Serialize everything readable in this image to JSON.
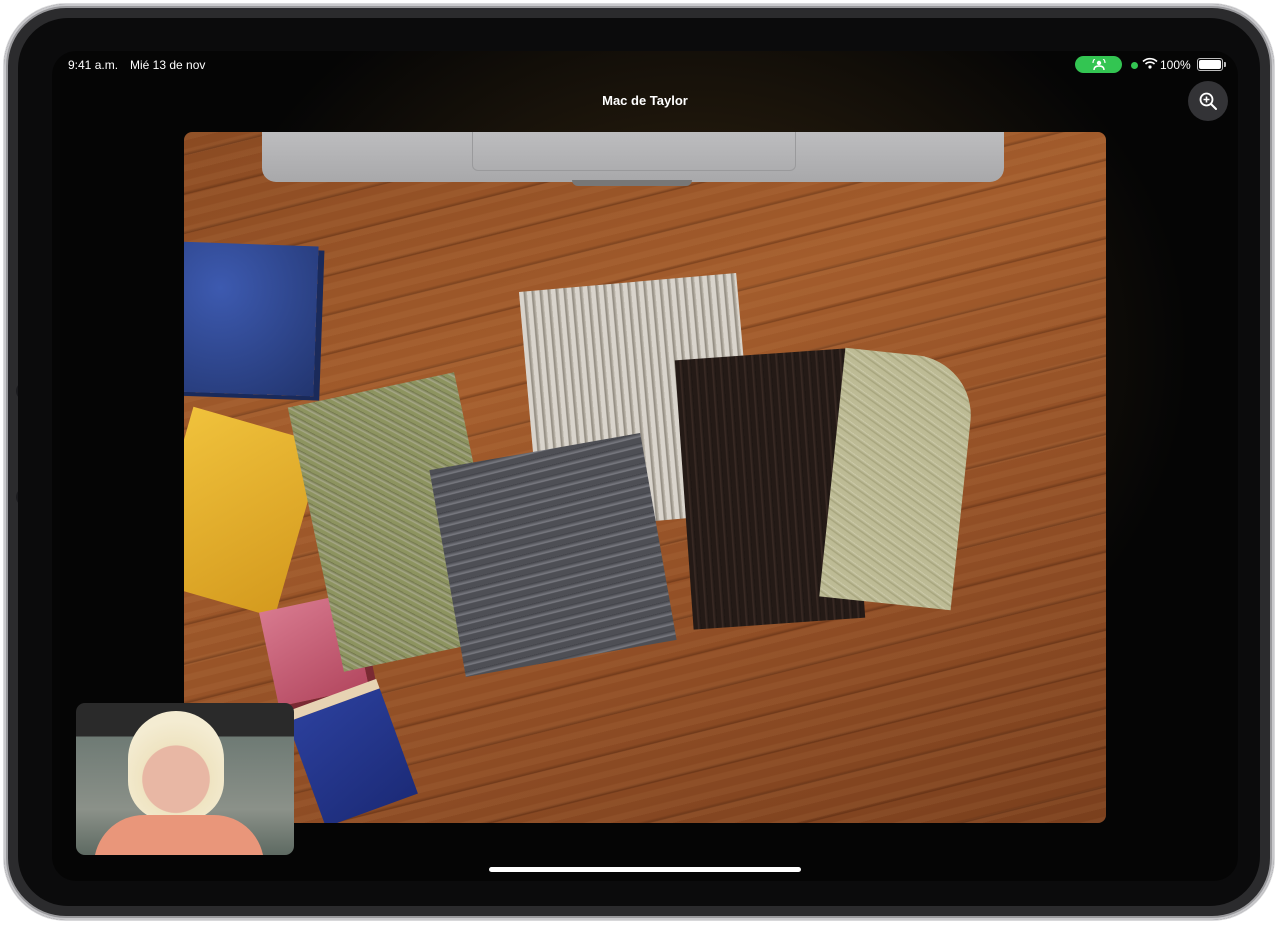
{
  "status_bar": {
    "time": "9:41 a.m.",
    "date": "Mié 13 de nov",
    "battery": "100%",
    "shareplay_color": "#33c552"
  },
  "call": {
    "title": "Mac de Taylor",
    "zoom_icon": "magnifier-plus-icon"
  },
  "video": {
    "content": "desk-view-camera-feed",
    "self_view": "self-view-camera"
  }
}
